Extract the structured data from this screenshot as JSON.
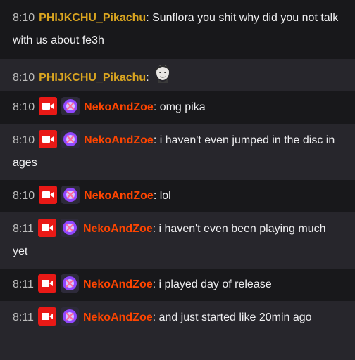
{
  "messages": [
    {
      "time": "8:10",
      "user": "PHIJKCHU_Pikachu",
      "sep": ": ",
      "text": "Sunflora you shit why did you not talk with us about fe3h"
    },
    {
      "time": "8:10",
      "user": "PHIJKCHU_Pikachu",
      "sep": ":",
      "text": ""
    },
    {
      "time": "8:10",
      "user": "NekoAndZoe",
      "sep": ": ",
      "text": "omg pika"
    },
    {
      "time": "8:10",
      "user": "NekoAndZoe",
      "sep": ": ",
      "text": "i haven't even jumped in the disc in ages"
    },
    {
      "time": "8:10",
      "user": "NekoAndZoe",
      "sep": ": ",
      "text": "lol"
    },
    {
      "time": "8:11",
      "user": "NekoAndZoe",
      "sep": ": ",
      "text": "i haven't even been playing much yet"
    },
    {
      "time": "8:11",
      "user": "NekoAndZoe",
      "sep": ": ",
      "text": "i played day of release"
    },
    {
      "time": "8:11",
      "user": "NekoAndZoe",
      "sep": ": ",
      "text": "and just started like 20min ago"
    }
  ],
  "colors": {
    "pikachu_name": "#daa520",
    "neko_name": "#ff4500",
    "badge_red": "#e91916",
    "badge_purple": "#9147ff"
  },
  "icons": {
    "video_badge": "video-camera-icon",
    "sub_badge": "sub-badge-icon",
    "emote": "face-emote-icon"
  }
}
